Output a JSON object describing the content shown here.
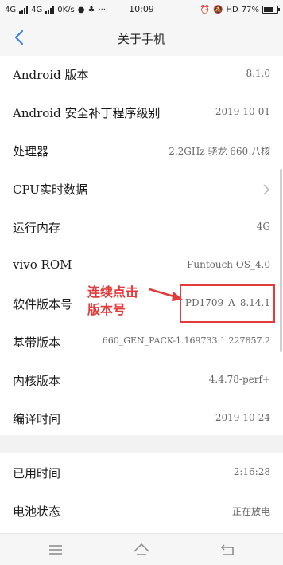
{
  "status_bar": {
    "network_1": "4G",
    "network_2": "4G",
    "speed": "0K/s",
    "more": "···",
    "time": "10:09",
    "hd_label": "HD",
    "battery_percent": "77%",
    "battery_level": 0.77
  },
  "header": {
    "title": "关于手机"
  },
  "rows": [
    {
      "label": "Android 版本",
      "value": "8.1.0"
    },
    {
      "label": "Android 安全补丁程序级别",
      "value": "2019-10-01"
    },
    {
      "label": "处理器",
      "value": "2.2GHz 骁龙 660 八核"
    },
    {
      "label": "CPU实时数据",
      "value": ""
    },
    {
      "label": "运行内存",
      "value": "4G"
    },
    {
      "label": "vivo ROM",
      "value": "Funtouch OS_4.0"
    },
    {
      "label": "软件版本号",
      "value": "PD1709_A_8.14.1"
    },
    {
      "label": "基带版本",
      "value": "660_GEN_PACK-1.169733.1.227857.2"
    },
    {
      "label": "内核版本",
      "value": "4.4.78-perf+"
    },
    {
      "label": "编译时间",
      "value": "2019-10-24"
    },
    {
      "label": "已用时间",
      "value": "2:16:28"
    },
    {
      "label": "电池状态",
      "value": "正在放电"
    }
  ],
  "annotation": {
    "line1": "连续点击",
    "line2": "版本号",
    "color": "#e23b3b"
  }
}
